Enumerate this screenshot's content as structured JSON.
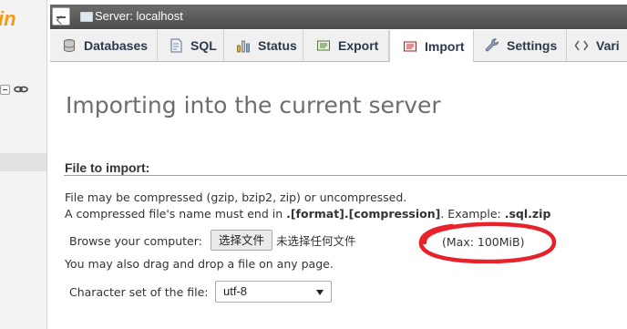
{
  "nav": {
    "logo_text": "in"
  },
  "topbar": {
    "server_label": "Server: localhost"
  },
  "tabs": [
    {
      "label": "Databases",
      "icon": "databases-icon"
    },
    {
      "label": "SQL",
      "icon": "sql-icon"
    },
    {
      "label": "Status",
      "icon": "status-icon"
    },
    {
      "label": "Export",
      "icon": "export-icon"
    },
    {
      "label": "Import",
      "icon": "import-icon",
      "active": true
    },
    {
      "label": "Settings",
      "icon": "settings-icon"
    },
    {
      "label": "Vari",
      "icon": "variables-icon"
    }
  ],
  "main": {
    "title": "Importing into the current server",
    "section_title": "File to import:",
    "compress_line1": "File may be compressed (gzip, bzip2, zip) or uncompressed.",
    "compress_line2_prefix": "A compressed file's name must end in ",
    "compress_line2_format": ".[format].[compression]",
    "compress_line2_mid": ". Example: ",
    "compress_line2_example": ".sql.zip",
    "browse_label": "Browse your computer:",
    "browse_button": "选择文件",
    "no_file": "未选择任何文件",
    "max_size": "(Max: 100MiB)",
    "drag_hint": "You may also drag and drop a file on any page.",
    "charset_label": "Character set of the file:",
    "charset_value": "utf-8"
  },
  "colors": {
    "annotation": "#e8222a",
    "logo": "#f39a12",
    "topbar": "#5a5a5a"
  }
}
